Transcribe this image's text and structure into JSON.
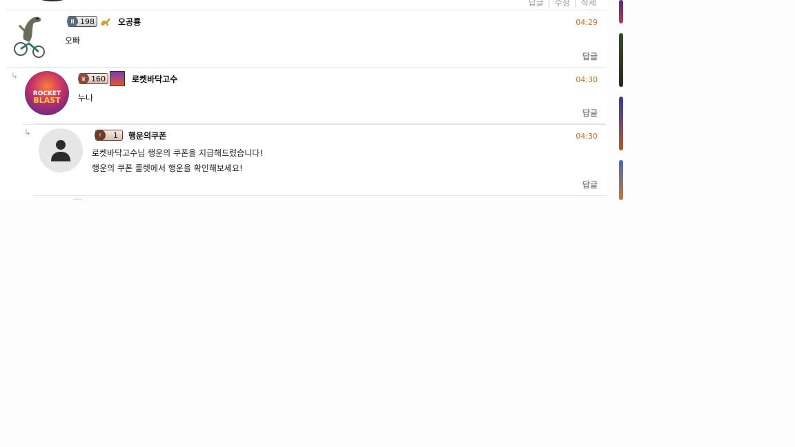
{
  "top_row": {
    "actions": [
      "답글",
      "수정",
      "삭제"
    ]
  },
  "comments": [
    {
      "level": "198",
      "nickname": "오공룡",
      "time": "04:29",
      "text": [
        "오빠"
      ],
      "reply_label": "답글"
    },
    {
      "level": "160",
      "nickname": "로켓바닥고수",
      "time": "04:30",
      "text": [
        "누나"
      ],
      "reply_label": "답글",
      "avatar_text": [
        "ROCKET",
        "BLAST"
      ]
    },
    {
      "level": "1",
      "nickname": "행운의쿠폰",
      "time": "04:30",
      "text": [
        "로켓바닥고수님 행운의 쿠폰을 지급해드렸습니다!",
        "행운의 쿠폰 룰렛에서 행운을 확인해보세요!"
      ],
      "reply_label": "답글"
    }
  ],
  "reply_arrow": "↳",
  "colors": {
    "time": "#d2691e",
    "reply": "#888888",
    "divider": "#e3e3e3"
  }
}
